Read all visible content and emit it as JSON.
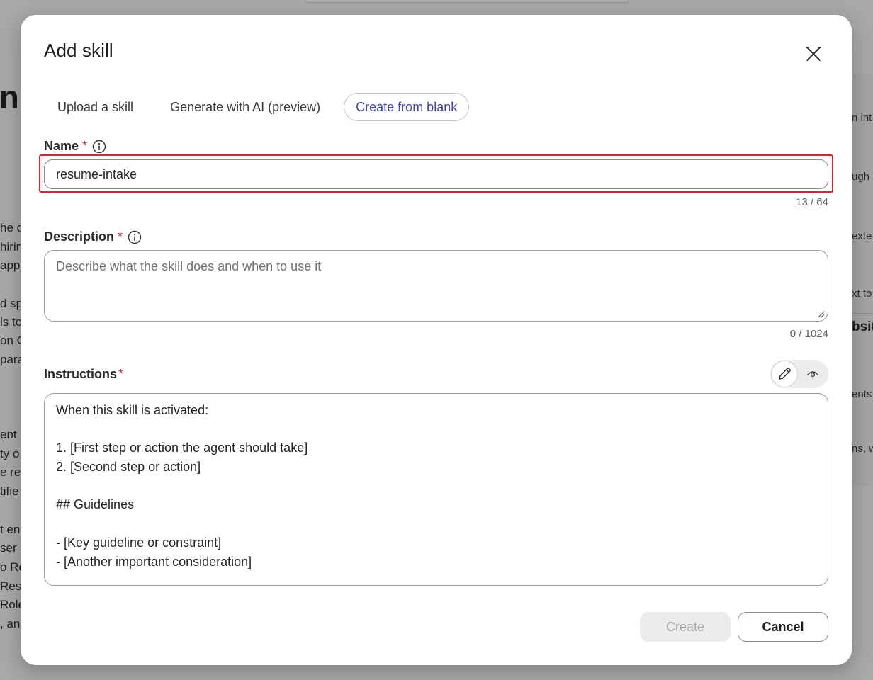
{
  "background": {
    "heading_fragment": "in",
    "left_lines": [
      "he ce",
      "hirin",
      "app",
      "",
      "d sp",
      "ls to",
      "on C",
      "parat",
      "",
      "",
      "ent",
      "ty o",
      "e res",
      "tifie",
      "",
      "t en",
      "ser s",
      "o Ro",
      "Res",
      "Role",
      ", an"
    ],
    "right_lines": [
      "n int",
      "ugh",
      "exte",
      "xt to",
      "bsite",
      "ents",
      "ns, w"
    ]
  },
  "dialog": {
    "title": "Add skill",
    "close_label": "Close",
    "tabs": [
      {
        "label": "Upload a skill",
        "active": false
      },
      {
        "label": "Generate with AI (preview)",
        "active": false
      },
      {
        "label": "Create from blank",
        "active": true
      }
    ],
    "name_field": {
      "label": "Name",
      "required_mark": "*",
      "value": "resume-intake",
      "counter": "13 / 64"
    },
    "description_field": {
      "label": "Description",
      "required_mark": "*",
      "placeholder": "Describe what the skill does and when to use it",
      "value": "",
      "counter": "0 / 1024"
    },
    "instructions_field": {
      "label": "Instructions",
      "required_mark": "*",
      "mode": "edit",
      "lines": [
        "When this skill is activated:",
        "",
        "1. [First step or action the agent should take]",
        "2. [Second step or action]",
        "",
        "## Guidelines",
        "",
        "- [Key guideline or constraint]",
        "- [Another important consideration]"
      ]
    },
    "buttons": {
      "create": "Create",
      "cancel": "Cancel"
    }
  },
  "colors": {
    "accent": "#3f43c0",
    "required": "#c4314b",
    "highlight": "#d4272e"
  }
}
